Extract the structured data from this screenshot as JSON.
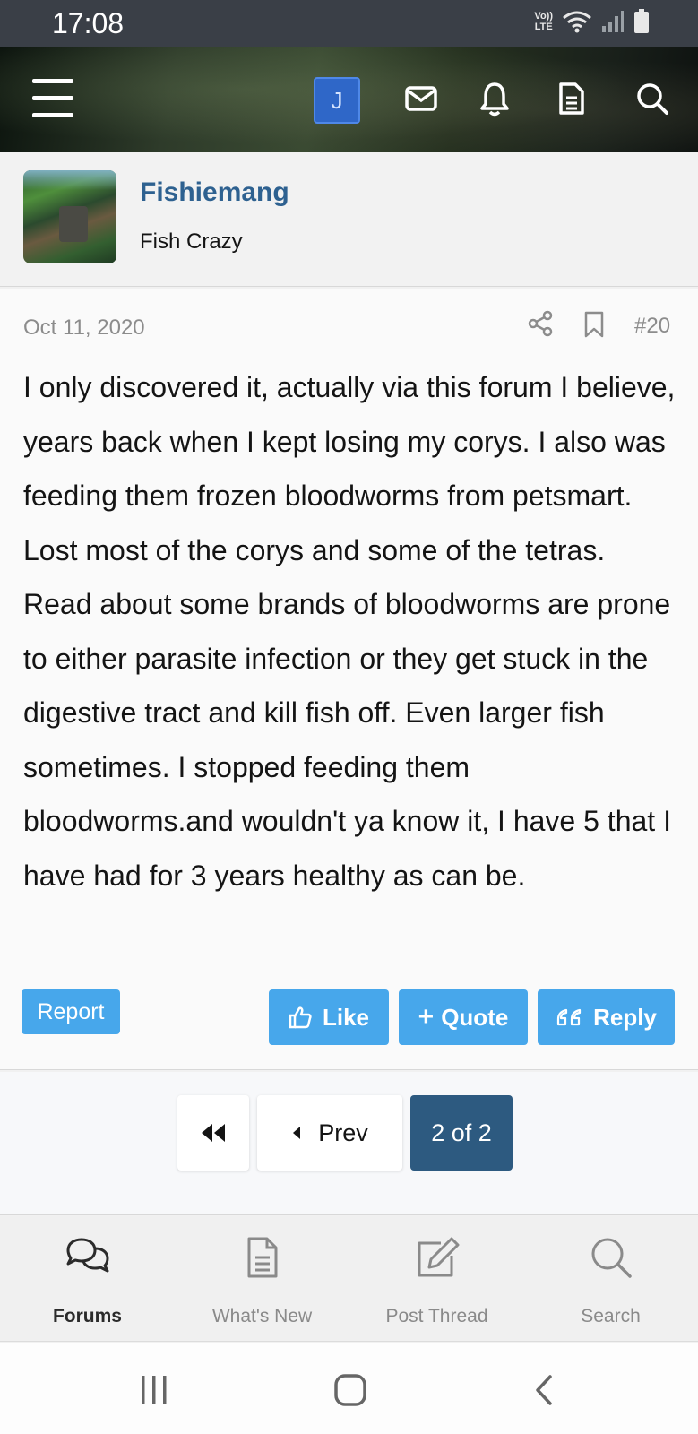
{
  "status_bar": {
    "time": "17:08",
    "volte_line1": "Vo))",
    "volte_line2": "LTE"
  },
  "header": {
    "avatar_letter": "J"
  },
  "user": {
    "name": "Fishiemang",
    "title": "Fish Crazy"
  },
  "post": {
    "date": "Oct 11, 2020",
    "number": "#20",
    "body": "I only discovered it, actually via this forum I believe, years back when I kept losing my corys. I also was feeding them frozen bloodworms from petsmart. Lost most of the corys and some of the tetras. Read about some brands of bloodworms are prone to either parasite infection or they get stuck in the digestive tract and kill fish off. Even larger fish sometimes. I stopped feeding them bloodworms.and wouldn't ya know it, I have 5 that I have had for 3 years healthy as can be.",
    "actions": {
      "report": "Report",
      "like": "Like",
      "quote": "Quote",
      "reply": "Reply"
    }
  },
  "pagination": {
    "prev": "Prev",
    "current": "2 of 2"
  },
  "tab_bar": {
    "forums": "Forums",
    "whats_new": "What's New",
    "post_thread": "Post Thread",
    "search": "Search"
  },
  "colors": {
    "accent": "#47a7eb",
    "username": "#2e6190",
    "current_page": "#2d5a80",
    "status_bar": "#3a3f47"
  }
}
